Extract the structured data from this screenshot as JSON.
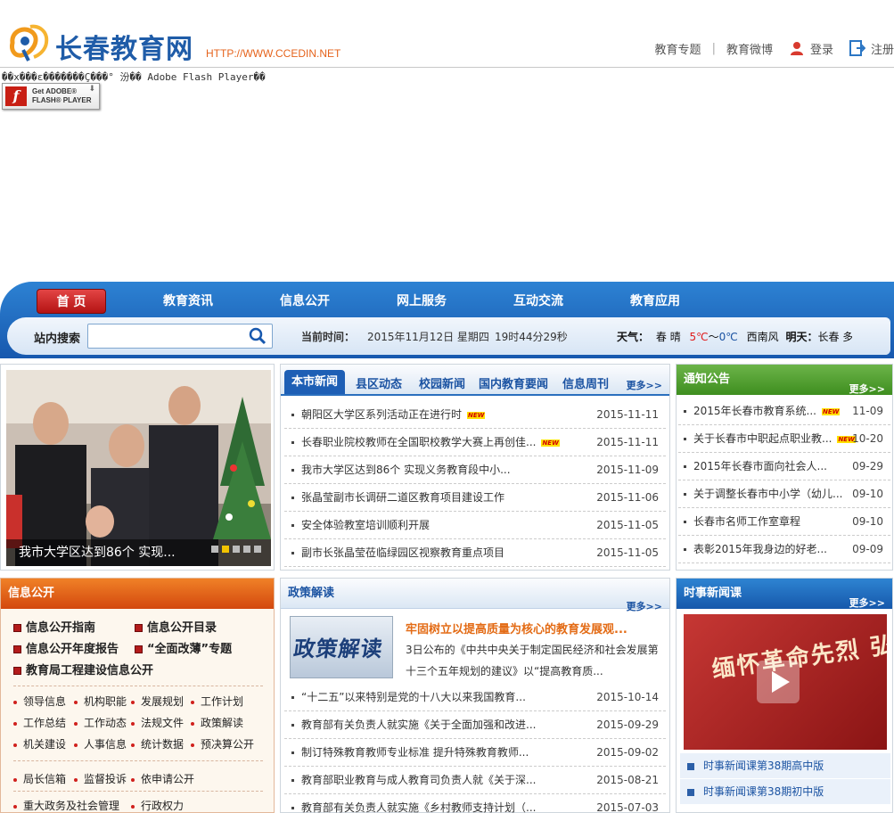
{
  "header": {
    "site_name": "长春教育网",
    "url": "HTTP://WWW.CCEDIN.NET",
    "links": [
      "教育专题",
      "教育微博"
    ],
    "login": "登录",
    "register": "注册"
  },
  "flash": {
    "message": "��x���ε�������Ç���° 汾�� Adobe Flash Player��",
    "get_line1": "Get ADOBE®",
    "get_line2": "FLASH® PLAYER"
  },
  "nav": {
    "items": [
      "首 页",
      "教育资讯",
      "信息公开",
      "网上服务",
      "互动交流",
      "教育应用"
    ],
    "active": 0
  },
  "search": {
    "label": "站内搜索",
    "placeholder": "",
    "time_label": "当前时间：",
    "date": "2015年11月12日 星期四",
    "clock": "19时44分29秒",
    "weather_label": "天气：",
    "weather_city": "春",
    "weather_cond": "晴",
    "temp_high": "5℃",
    "temp_sep": "～",
    "temp_low": "0℃",
    "wind": "西南风",
    "tomorrow_label": "明天：",
    "tomorrow_text": "长春 多"
  },
  "slider": {
    "caption": "我市大学区达到86个 实现...",
    "dots": 5,
    "active_dot": 1
  },
  "news": {
    "tabs": [
      "本市新闻",
      "县区动态",
      "校园新闻",
      "国内教育要闻",
      "信息周刊"
    ],
    "more": "更多>>",
    "items": [
      {
        "title": "朝阳区大学区系列活动正在进行时",
        "date": "2015-11-11",
        "new": true
      },
      {
        "title": "长春职业院校教师在全国职校教学大赛上再创佳...",
        "date": "2015-11-11",
        "new": true
      },
      {
        "title": "我市大学区达到86个 实现义务教育段中小...",
        "date": "2015-11-09",
        "new": false
      },
      {
        "title": "张晶莹副市长调研二道区教育项目建设工作",
        "date": "2015-11-06",
        "new": false
      },
      {
        "title": "安全体验教室培训顺利开展",
        "date": "2015-11-05",
        "new": false
      },
      {
        "title": "副市长张晶莹莅临绿园区视察教育重点项目",
        "date": "2015-11-05",
        "new": false
      }
    ]
  },
  "notice": {
    "title": "通知公告",
    "more": "更多>>",
    "items": [
      {
        "title": "2015年长春市教育系统...",
        "date": "11-09",
        "new": true
      },
      {
        "title": "关于长春市中职起点职业教...",
        "date": "10-20",
        "new": true
      },
      {
        "title": "2015年长春市面向社会人...",
        "date": "09-29",
        "new": false
      },
      {
        "title": "关于调整长春市中小学（幼儿...",
        "date": "09-10",
        "new": false
      },
      {
        "title": "长春市名师工作室章程",
        "date": "09-10",
        "new": false
      },
      {
        "title": "表彰2015年我身边的好老...",
        "date": "09-09",
        "new": false
      }
    ]
  },
  "new_badge": "NEW",
  "info": {
    "title": "信息公开",
    "big": [
      "信息公开指南",
      "信息公开目录",
      "信息公开年度报告",
      "“全面改薄”专题",
      "教育局工程建设信息公开"
    ],
    "row1": [
      "领导信息",
      "机构职能",
      "发展规划",
      "工作计划"
    ],
    "row2": [
      "工作总结",
      "工作动态",
      "法规文件",
      "政策解读"
    ],
    "row3": [
      "机关建设",
      "人事信息",
      "统计数据",
      "预决算公开"
    ],
    "row4": [
      "局长信箱",
      "监督投诉",
      "依申请公开"
    ],
    "row5": [
      "重大政务及社会管理",
      "行政权力"
    ]
  },
  "policy": {
    "title": "政策解读",
    "more": "更多>>",
    "image_text": "政策解读",
    "feature_title": "牢固树立以提高质量为核心的教育发展观...",
    "feature_abstract": "3日公布的《中共中央关于制定国民经济和社会发展第十三个五年规划的建议》以“提高教育质...",
    "items": [
      {
        "title": "“十二五”以来特别是党的十八大以来我国教育...",
        "date": "2015-10-14"
      },
      {
        "title": "教育部有关负责人就实施《关于全面加强和改进...",
        "date": "2015-09-29"
      },
      {
        "title": "制订特殊教育教师专业标准 提升特殊教育教师...",
        "date": "2015-09-02"
      },
      {
        "title": "教育部职业教育与成人教育司负责人就《关于深...",
        "date": "2015-08-21"
      },
      {
        "title": "教育部有关负责人就实施《乡村教师支持计划（...",
        "date": "2015-07-03"
      }
    ]
  },
  "video": {
    "title": "时事新闻课",
    "more": "更多>>",
    "banner_text": "缅怀革命先烈 弘扬抗战精神",
    "items": [
      "时事新闻课第38期高中版",
      "时事新闻课第38期初中版"
    ]
  },
  "colors": {
    "brand_blue": "#1f5ca8",
    "url_orange": "#e5631c",
    "nav_blue": "#1758ae",
    "active_red": "#c41b1b",
    "notice_green": "#3e8e1f",
    "info_orange": "#d3480e"
  }
}
